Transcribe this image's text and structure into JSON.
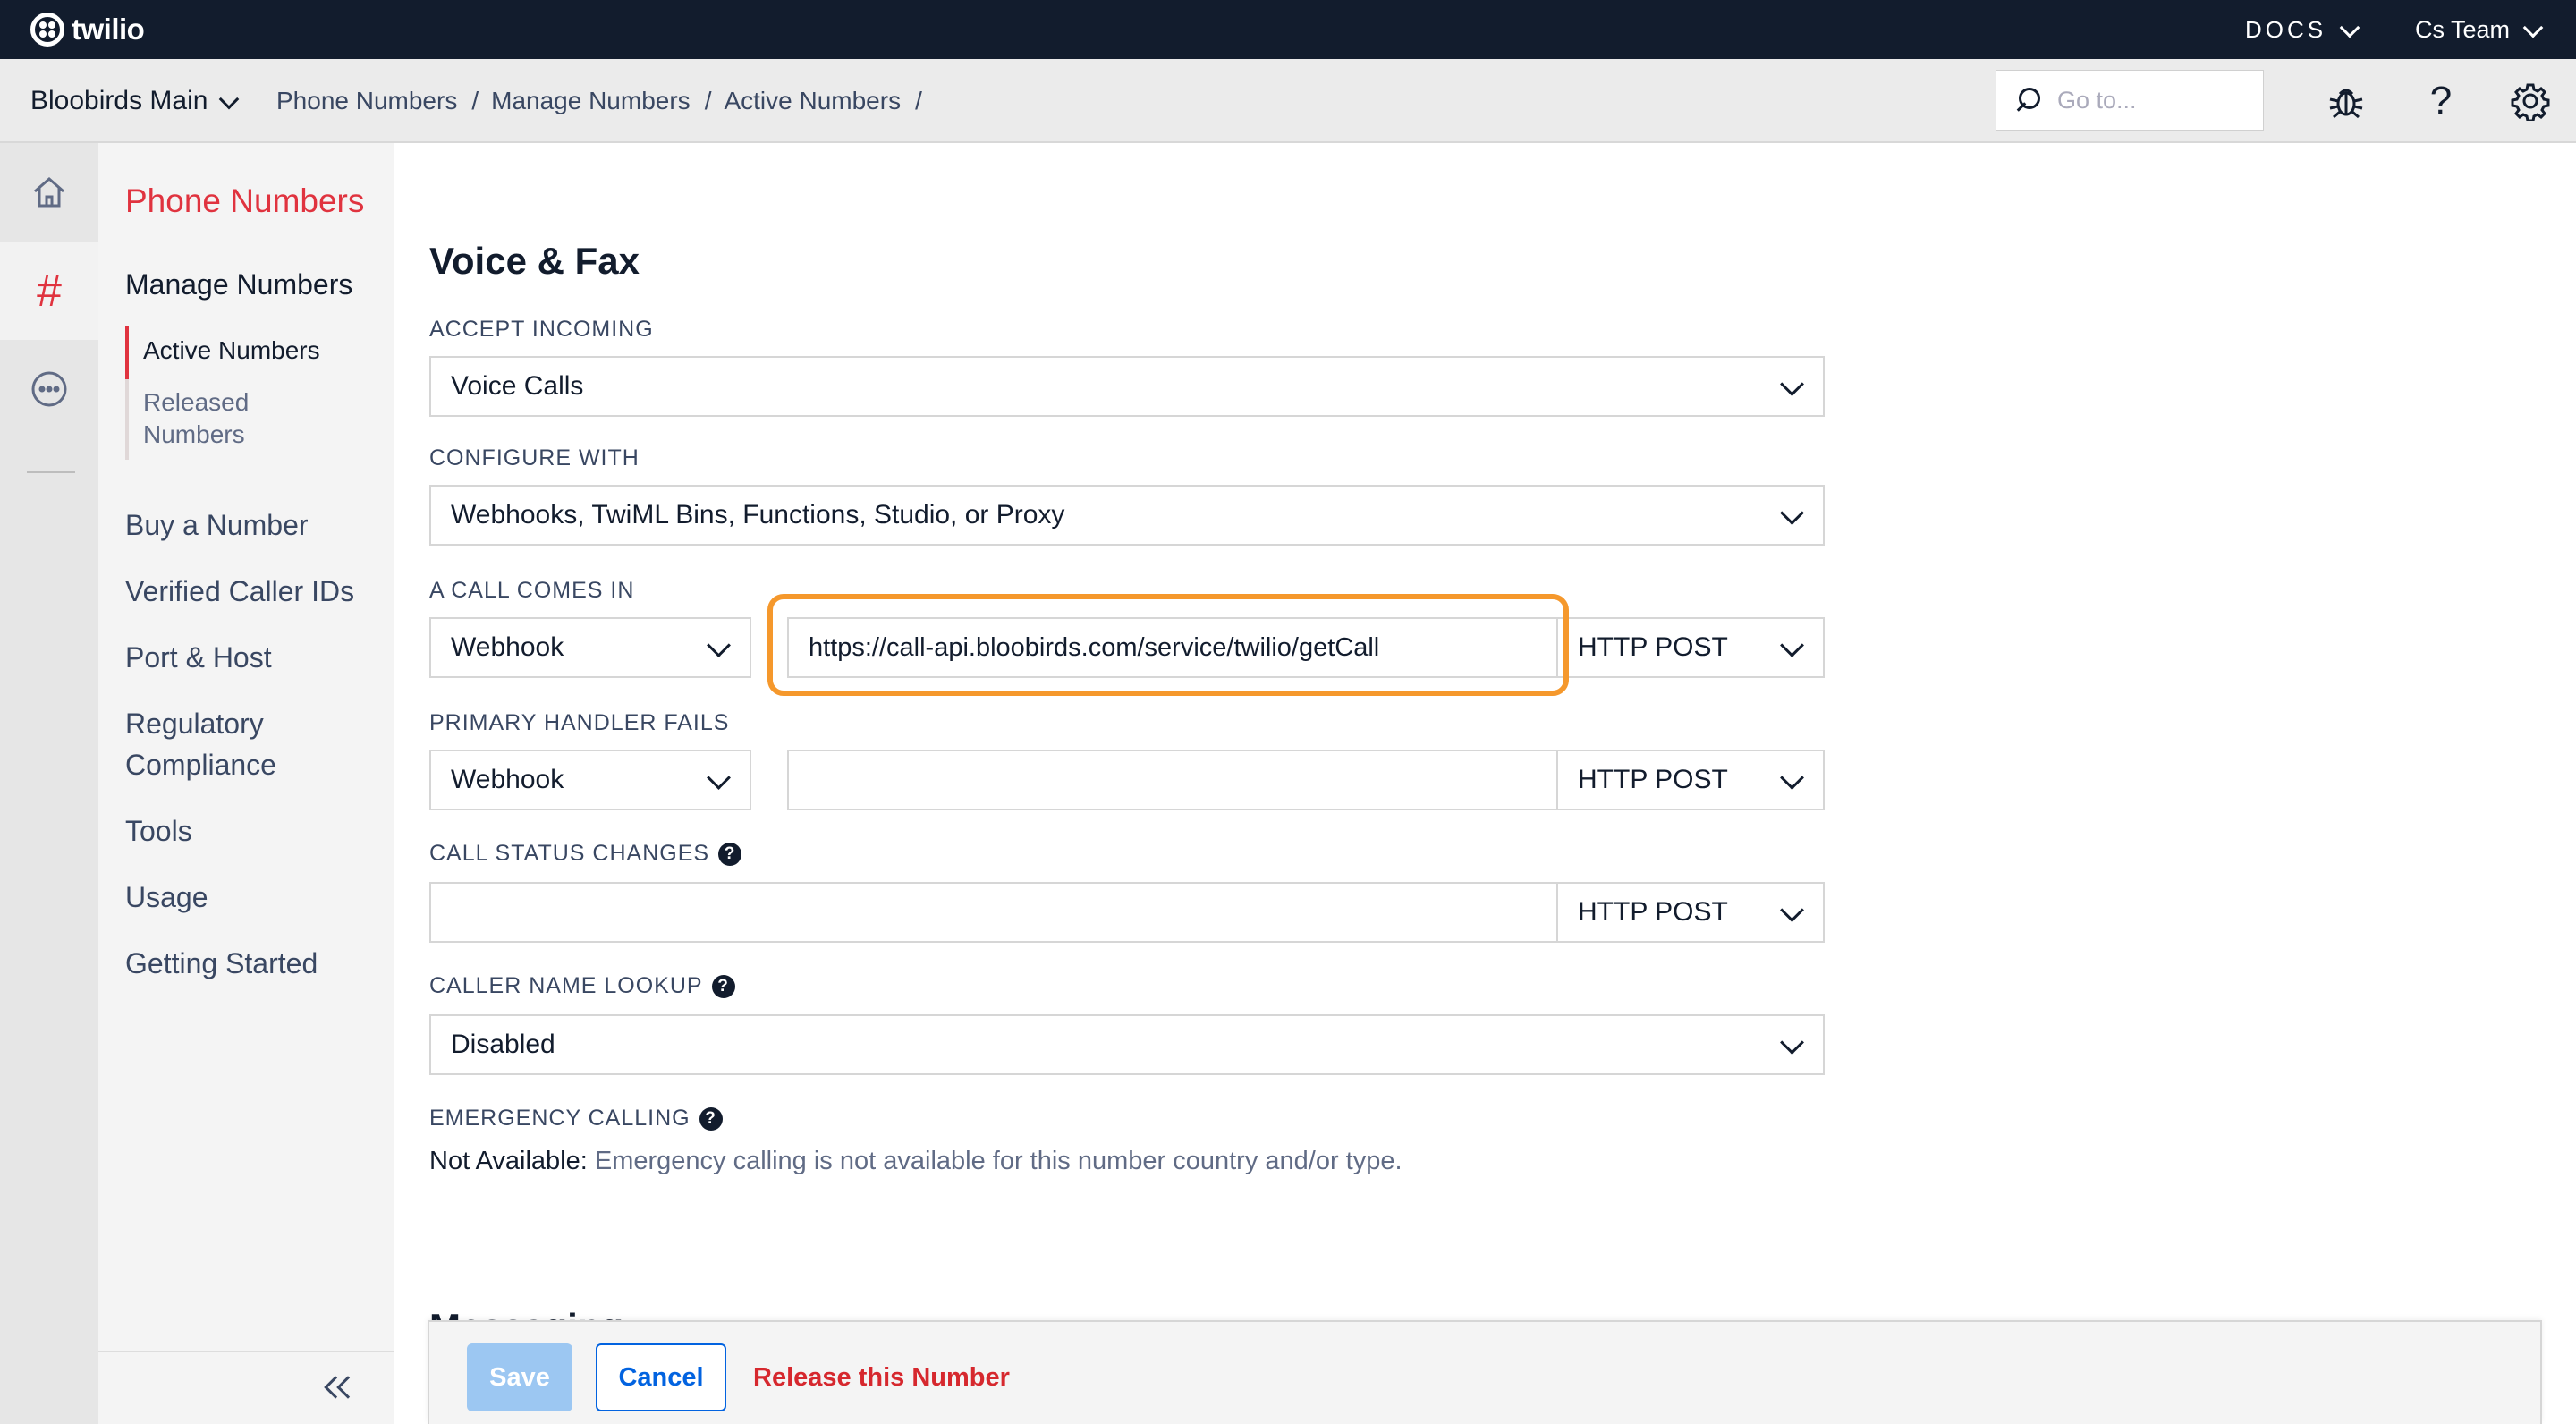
{
  "topbar": {
    "logo_text": "twilio",
    "docs_label": "DOCS",
    "team_label": "Cs Team"
  },
  "subbar": {
    "account_name": "Bloobirds Main",
    "breadcrumbs": [
      "Phone Numbers",
      "Manage Numbers",
      "Active Numbers"
    ],
    "search_placeholder": "Go to..."
  },
  "sidenav": {
    "title": "Phone Numbers",
    "section": "Manage Numbers",
    "children": [
      {
        "label": "Active Numbers",
        "active": true
      },
      {
        "label": "Released Numbers",
        "active": false
      }
    ],
    "items": [
      "Buy a Number",
      "Verified Caller IDs",
      "Port & Host",
      "Regulatory Compliance",
      "Tools",
      "Usage",
      "Getting Started"
    ]
  },
  "voice_fax": {
    "heading": "Voice & Fax",
    "accept_incoming": {
      "label": "ACCEPT INCOMING",
      "value": "Voice Calls"
    },
    "configure_with": {
      "label": "CONFIGURE WITH",
      "value": "Webhooks, TwiML Bins, Functions, Studio, or Proxy"
    },
    "call_comes_in": {
      "label": "A CALL COMES IN",
      "type": "Webhook",
      "url": "https://call-api.bloobirds.com/service/twilio/getCall",
      "method": "HTTP POST"
    },
    "primary_handler_fails": {
      "label": "PRIMARY HANDLER FAILS",
      "type": "Webhook",
      "url": "",
      "method": "HTTP POST"
    },
    "call_status_changes": {
      "label": "CALL STATUS CHANGES",
      "url": "",
      "method": "HTTP POST"
    },
    "caller_name_lookup": {
      "label": "CALLER NAME LOOKUP",
      "value": "Disabled"
    },
    "emergency_calling": {
      "label": "EMERGENCY CALLING",
      "status_label": "Not Available:",
      "status_text": " Emergency calling is not available for this number country and/or type."
    }
  },
  "messaging_heading": "Messaging",
  "footer": {
    "save_label": "Save",
    "cancel_label": "Cancel",
    "release_label": "Release this Number"
  },
  "colors": {
    "brand_red": "#e0333f",
    "navy": "#121c2d",
    "highlight_orange": "#f5982c",
    "link_blue": "#0263e0"
  }
}
